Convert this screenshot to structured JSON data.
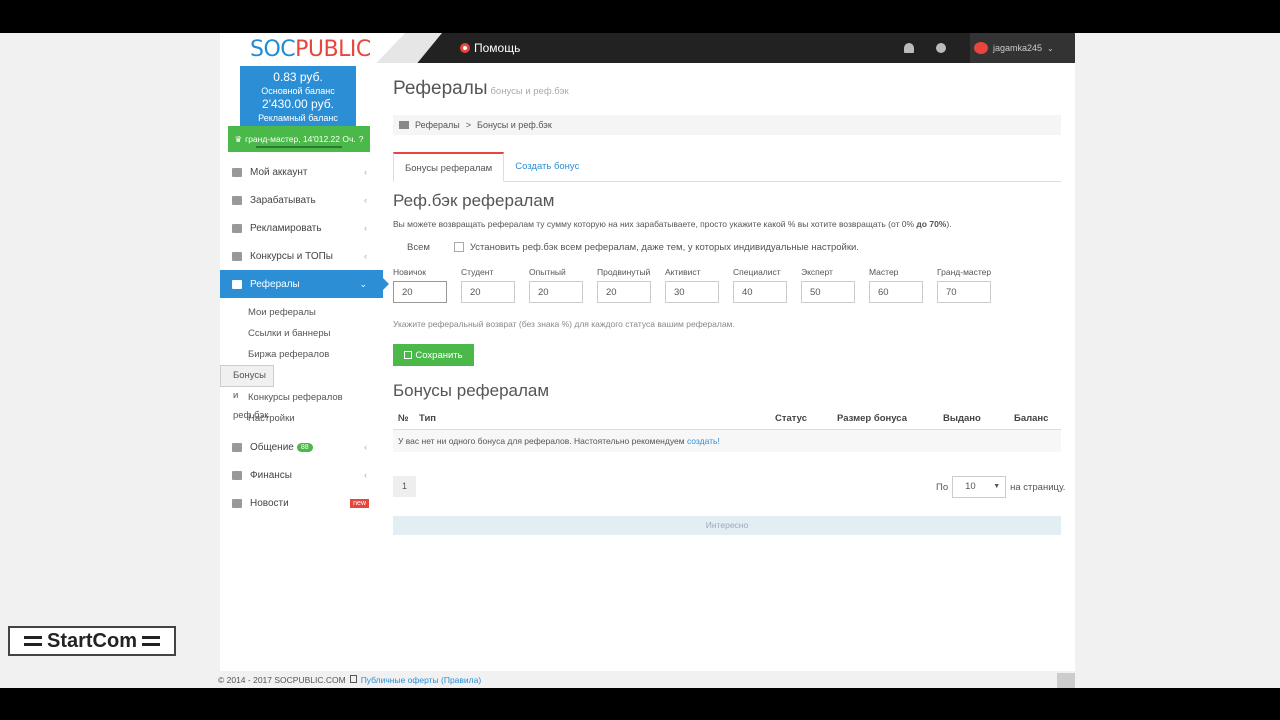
{
  "header": {
    "logo_soc": "SOC",
    "logo_public": "PUBLIC",
    "help_label": "Помощь",
    "username": "jagamka245"
  },
  "balance": {
    "main_value": "0.83 руб.",
    "main_label": "Основной баланс",
    "ad_value": "2'430.00 руб.",
    "ad_label": "Рекламный баланс",
    "rank": "гранд-мастер, 14'012.22 Оч."
  },
  "menu": {
    "items": [
      {
        "label": "Мой аккаунт"
      },
      {
        "label": "Зарабатывать"
      },
      {
        "label": "Рекламировать"
      },
      {
        "label": "Конкурсы и ТОПы"
      },
      {
        "label": "Рефералы"
      }
    ],
    "submenu": [
      {
        "label": "Мои рефералы"
      },
      {
        "label": "Ссылки и баннеры"
      },
      {
        "label": "Биржа рефералов"
      },
      {
        "label": "Бонусы и реф.бэк"
      },
      {
        "label": "Конкурсы рефералов"
      },
      {
        "label": "Настройки"
      }
    ],
    "after": [
      {
        "label": "Общение",
        "badge": "88"
      },
      {
        "label": "Финансы"
      },
      {
        "label": "Новости",
        "badge": "new"
      }
    ]
  },
  "main": {
    "title": "Рефералы",
    "subtitle": "бонусы и реф.бэк",
    "breadcrumb": [
      "Рефералы",
      ">",
      "Бонусы и реф.бэк"
    ],
    "tabs": [
      {
        "label": "Бонусы рефералам"
      },
      {
        "label": "Создать бонус"
      }
    ],
    "refback_title": "Реф.бэк рефералам",
    "refback_desc": "Вы можете возвращать рефералам ту сумму которую на них зарабатываете, просто укажите какой % вы хотите возвращать (от 0%",
    "refback_desc_bold": "до 70%",
    "refback_desc_end": ").",
    "all_label": "Всем",
    "all_checkbox_label": "Установить реф.бэк всем рефералам, даже тем, у которых индивидуальные настройки.",
    "levels": [
      {
        "label": "Новичок",
        "value": "20"
      },
      {
        "label": "Студент",
        "value": "20"
      },
      {
        "label": "Опытный",
        "value": "20"
      },
      {
        "label": "Продвинутый",
        "value": "20"
      },
      {
        "label": "Активист",
        "value": "30"
      },
      {
        "label": "Специалист",
        "value": "40"
      },
      {
        "label": "Эксперт",
        "value": "50"
      },
      {
        "label": "Мастер",
        "value": "60"
      },
      {
        "label": "Гранд-мастер",
        "value": "70"
      }
    ],
    "hint": "Укажите реферальный возврат (без знака %) для каждого статуса вашим рефералам.",
    "save_label": "Сохранить",
    "bonuses_title": "Бонусы рефералам",
    "table_headers": [
      "№",
      "Тип",
      "Статус",
      "Размер бонуса",
      "Выдано",
      "Баланс"
    ],
    "empty_text": "У вас нет ни одного бонуса для рефералов. Настоятельно рекомендуем",
    "empty_link": "создать!",
    "page": "1",
    "per_page_prefix": "По",
    "per_page_value": "10",
    "per_page_suffix": "на страницу.",
    "more_label": "Интересно"
  },
  "footer": {
    "copyright": "© 2014 - 2017 SOCPUBLIC.COM",
    "offer_link": "Публичные оферты (Правила)"
  },
  "watermark": "StartCom"
}
